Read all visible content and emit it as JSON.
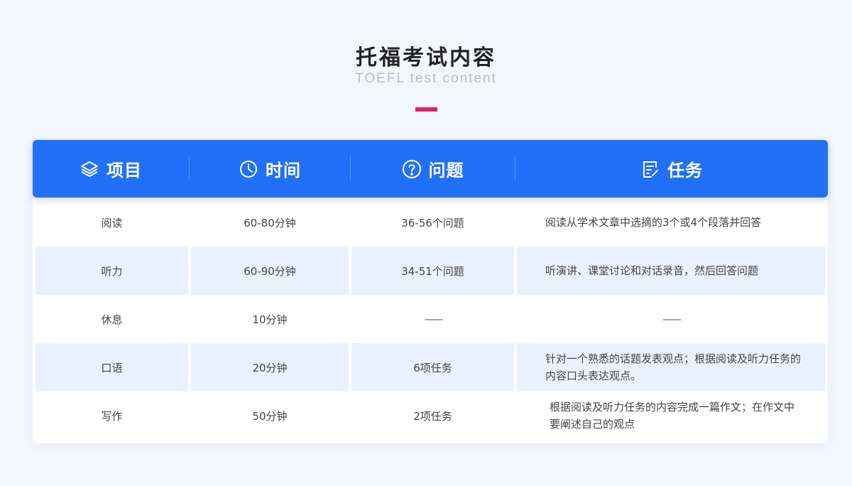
{
  "page": {
    "title": "托福考试内容",
    "subtitle": "TOEFL test content",
    "accent_color": "#e01f6b"
  },
  "table": {
    "header_color": "#2170f7",
    "headers": [
      {
        "label": "项目",
        "icon": "layers-icon"
      },
      {
        "label": "时间",
        "icon": "clock-icon"
      },
      {
        "label": "问题",
        "icon": "question-circle-icon"
      },
      {
        "label": "任务",
        "icon": "task-list-icon"
      }
    ],
    "rows": [
      {
        "item": "阅读",
        "time": "60-80分钟",
        "questions": "36-56个问题",
        "task": "阅读从学术文章中选摘的3个或4个段落并回答"
      },
      {
        "item": "听力",
        "time": "60-90分钟",
        "questions": "34-51个问题",
        "task": "听演讲、课堂讨论和对话录音，然后回答问题"
      },
      {
        "item": "休息",
        "time": "10分钟",
        "questions": "——",
        "task": "——"
      },
      {
        "item": "口语",
        "time": "20分钟",
        "questions": "6项任务",
        "task": "针对一个熟悉的话题发表观点；根据阅读及听力任务的内容口头表达观点。"
      },
      {
        "item": "写作",
        "time": "50分钟",
        "questions": "2项任务",
        "task": "根据阅读及听力任务的内容完成一篇作文；在作文中要阐述自己的观点"
      }
    ]
  }
}
